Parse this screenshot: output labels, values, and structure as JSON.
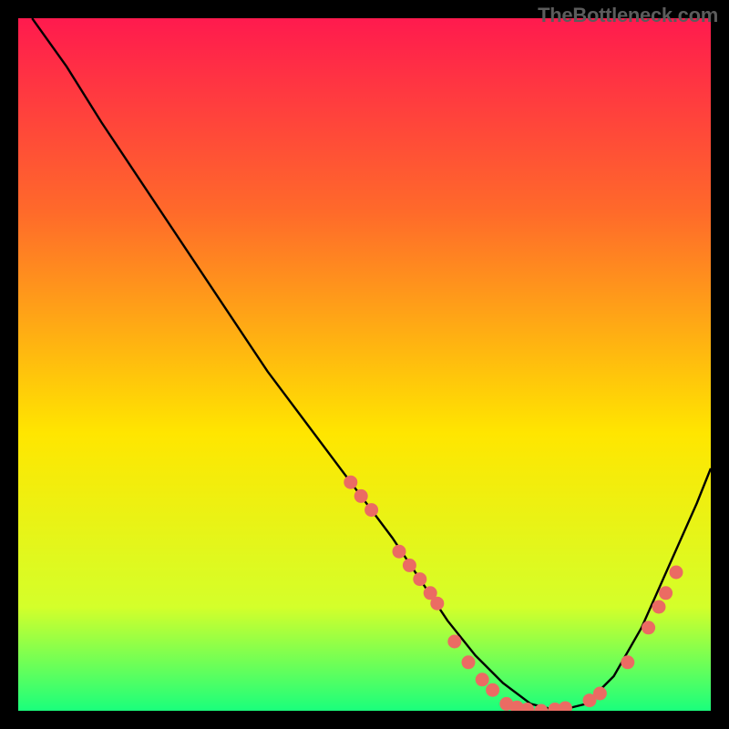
{
  "watermark": "TheBottleneck.com",
  "chart_data": {
    "type": "line",
    "title": "",
    "xlabel": "",
    "ylabel": "",
    "xlim": [
      0,
      100
    ],
    "ylim": [
      0,
      100
    ],
    "gradient": {
      "top": "#ff1a4e",
      "mid_upper": "#ff6a2a",
      "mid": "#ffe600",
      "mid_lower": "#d4ff2a",
      "bottom": "#1aff7c"
    },
    "curve": {
      "x": [
        2,
        7,
        12,
        18,
        24,
        30,
        36,
        42,
        48,
        54,
        58,
        62,
        66,
        70,
        74,
        78,
        82,
        86,
        90,
        94,
        98,
        100
      ],
      "y": [
        100,
        93,
        85,
        76,
        67,
        58,
        49,
        41,
        33,
        25,
        19,
        13,
        8,
        4,
        1,
        0,
        1,
        5,
        12,
        21,
        30,
        35
      ]
    },
    "markers": [
      {
        "x": 48,
        "y": 33
      },
      {
        "x": 49.5,
        "y": 31
      },
      {
        "x": 51,
        "y": 29
      },
      {
        "x": 55,
        "y": 23
      },
      {
        "x": 56.5,
        "y": 21
      },
      {
        "x": 58,
        "y": 19
      },
      {
        "x": 59.5,
        "y": 17
      },
      {
        "x": 60.5,
        "y": 15.5
      },
      {
        "x": 63,
        "y": 10
      },
      {
        "x": 65,
        "y": 7
      },
      {
        "x": 67,
        "y": 4.5
      },
      {
        "x": 68.5,
        "y": 3
      },
      {
        "x": 70.5,
        "y": 1
      },
      {
        "x": 72,
        "y": 0.5
      },
      {
        "x": 73.5,
        "y": 0.2
      },
      {
        "x": 75.5,
        "y": 0
      },
      {
        "x": 77.5,
        "y": 0.2
      },
      {
        "x": 79,
        "y": 0.4
      },
      {
        "x": 82.5,
        "y": 1.5
      },
      {
        "x": 84,
        "y": 2.5
      },
      {
        "x": 88,
        "y": 7
      },
      {
        "x": 91,
        "y": 12
      },
      {
        "x": 92.5,
        "y": 15
      },
      {
        "x": 93.5,
        "y": 17
      },
      {
        "x": 95,
        "y": 20
      }
    ],
    "marker_color": "#eb6b63",
    "curve_color": "#000000"
  }
}
